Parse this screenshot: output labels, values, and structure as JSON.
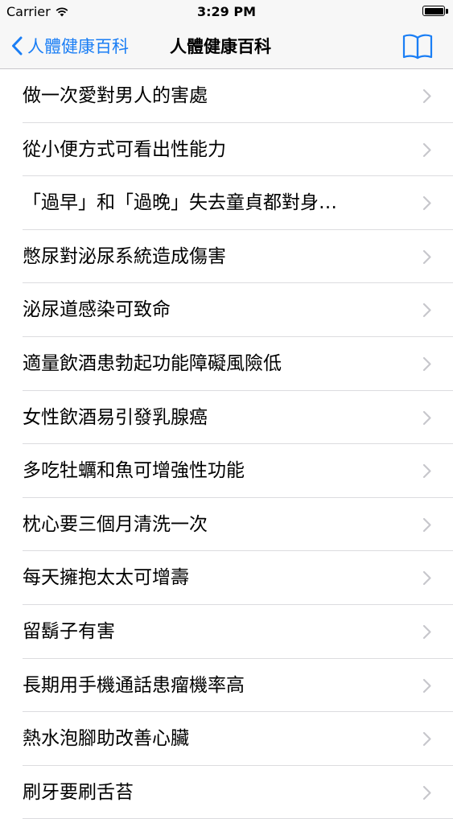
{
  "status_bar": {
    "carrier": "Carrier",
    "time": "3:29 PM"
  },
  "nav": {
    "back_label": "人體健康百科",
    "title": "人體健康百科",
    "accent_color": "#1a7ef5"
  },
  "articles": [
    "做一次愛對男人的害處",
    "從小便方式可看出性能力",
    "「過早」和「過晚」失去童貞都對身…",
    "憋尿對泌尿系統造成傷害",
    "泌尿道感染可致命",
    "適量飲酒患勃起功能障礙風險低",
    "女性飲酒易引發乳腺癌",
    "多吃牡蠣和魚可增強性功能",
    "枕心要三個月清洗一次",
    "每天擁抱太太可增壽",
    "留鬍子有害",
    "長期用手機通話患瘤機率高",
    "熱水泡腳助改善心臟",
    "刷牙要刷舌苔"
  ]
}
